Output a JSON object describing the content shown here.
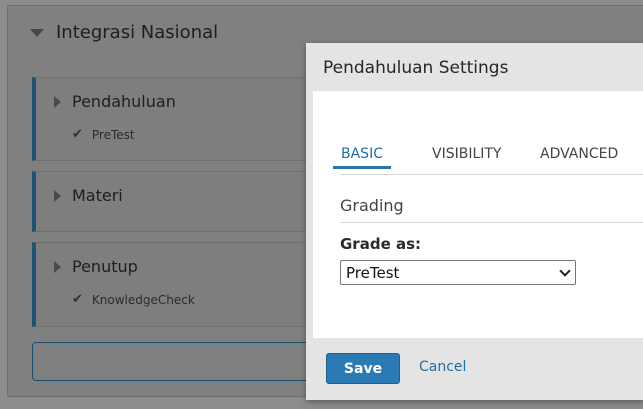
{
  "outline": {
    "section_title": "Integrasi Nasional",
    "subsections": [
      {
        "title": "Pendahuluan",
        "meta": "PreTest"
      },
      {
        "title": "Materi",
        "meta": ""
      },
      {
        "title": "Penutup",
        "meta": "KnowledgeCheck"
      }
    ]
  },
  "modal": {
    "title": "Pendahuluan Settings",
    "tabs": [
      "BASIC",
      "VISIBILITY",
      "ADVANCED"
    ],
    "active_tab": "BASIC",
    "grading_header": "Grading",
    "grade_as_label": "Grade as:",
    "grade_as_value": "PreTest",
    "save_label": "Save",
    "cancel_label": "Cancel"
  },
  "colors": {
    "accent": "#2b7ab6",
    "link": "#1f6ea3",
    "subsection_border": "#1c5476"
  }
}
